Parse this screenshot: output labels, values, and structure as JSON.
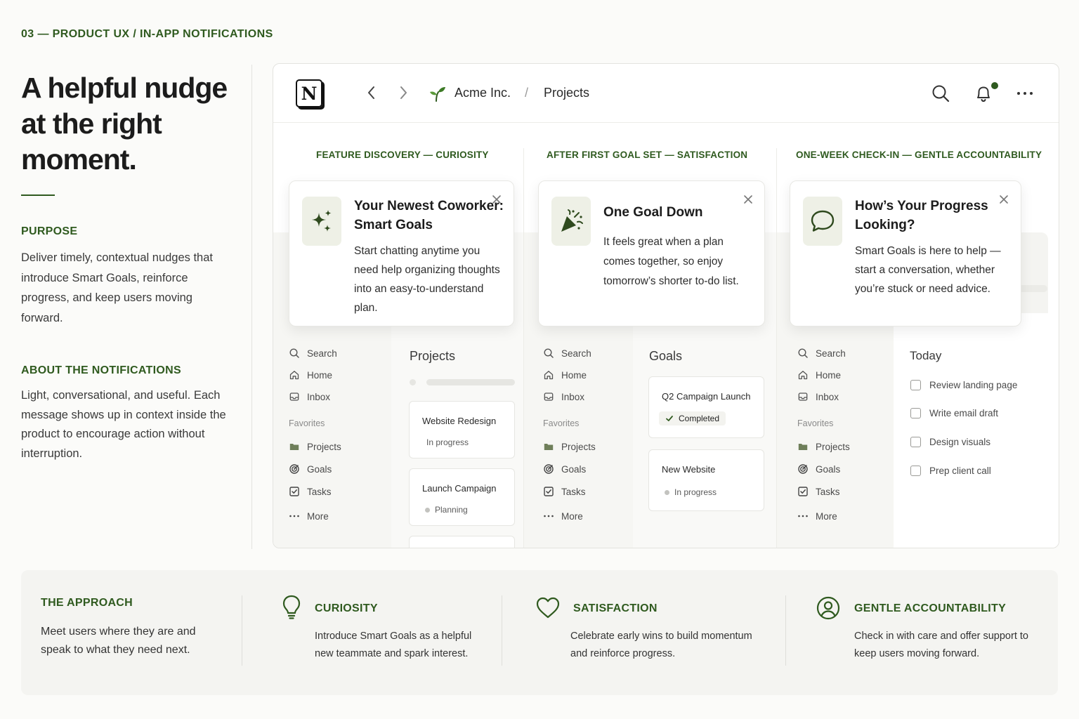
{
  "section_label": "03 — PRODUCT UX / IN-APP NOTIFICATIONS",
  "left": {
    "headline": "A helpful nudge at the right moment.",
    "purpose_heading": "PURPOSE",
    "purpose_body": "Deliver timely, contextual nudges that introduce Smart Goals, reinforce progress, and keep users moving forward.",
    "about_heading": "ABOUT THE NOTIFICATIONS",
    "about_body": "Light, conversational, and useful. Each message shows up in context inside the product to encourage action without interruption."
  },
  "topbar": {
    "logo_letter": "N",
    "workspace": "Acme Inc.",
    "separator": "/",
    "page": "Projects"
  },
  "sidebar": {
    "search": "Search",
    "home": "Home",
    "inbox": "Inbox",
    "favorites": "Favorites",
    "projects": "Projects",
    "goals": "Goals",
    "tasks": "Tasks",
    "more": "More"
  },
  "panels": [
    {
      "label": "FEATURE DISCOVERY — CURIOSITY",
      "notif_title": "Your Newest Coworker: Smart Goals",
      "notif_body": "Start chatting anytime you need help organizing thoughts into an easy-to-understand plan.",
      "main_title": "Projects",
      "cards": [
        {
          "title": "Website Redesign",
          "status": "In progress"
        },
        {
          "title": "Launch Campaign",
          "status": "Planning"
        }
      ]
    },
    {
      "label": "AFTER FIRST GOAL SET — SATISFACTION",
      "notif_title": "One Goal Down",
      "notif_body": "It feels great when a plan comes together, so enjoy tomorrow’s shorter to-do list.",
      "main_title": "Goals",
      "cards": [
        {
          "title": "Q2 Campaign Launch",
          "status": "Completed"
        },
        {
          "title": "New Website",
          "status": "In progress"
        }
      ]
    },
    {
      "label": "ONE-WEEK CHECK-IN — GENTLE ACCOUNTABILITY",
      "notif_title": "How’s Your Progress Looking?",
      "notif_body": "Smart Goals is here to help — start a conversation, whether you’re stuck or need advice.",
      "main_title": "Today",
      "todos": [
        "Review landing page",
        "Write email draft",
        "Design visuals",
        "Prep client call"
      ]
    }
  ],
  "approach": {
    "heading": "THE APPROACH",
    "body": "Meet users where they are and speak to what they need next.",
    "items": [
      {
        "heading": "CURIOSITY",
        "body": "Introduce Smart Goals as a helpful new teammate and spark interest."
      },
      {
        "heading": "SATISFACTION",
        "body": "Celebrate early wins to build momentum and reinforce progress."
      },
      {
        "heading": "GENTLE ACCOUNTABILITY",
        "body": "Check in with care and offer support to keep users moving forward."
      }
    ]
  },
  "colors": {
    "accent": "#2f5a1f",
    "background": "#fbfbf9"
  }
}
